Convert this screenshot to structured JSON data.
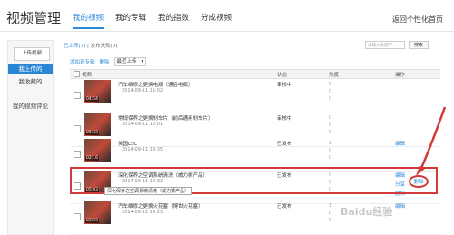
{
  "app_title": "视频管理",
  "tabs": [
    "我的视频",
    "我的专辑",
    "我的指数",
    "分成视频"
  ],
  "home_link": "返回个性化首页",
  "sidebar": {
    "upload": "上传视频",
    "items": [
      "我上传的",
      "我收藏的",
      "我的视频评论",
      "我的专辑"
    ]
  },
  "sub_tabs": [
    "已上传(7)",
    "发布失败(0)"
  ],
  "search": {
    "placeholder": "请输入关键字",
    "button": "搜索"
  },
  "toolbar": {
    "add": "添加到专辑",
    "delete": "删除",
    "sort": "最近上传"
  },
  "table_header": {
    "select": "视频",
    "status": "状态",
    "stats": "热度",
    "ops": "操作"
  },
  "rows": [
    {
      "title": "汽车维修之更换电瓶（通俗电瓶）",
      "date": "2014-09-11 15:02",
      "status": "审核中",
      "dur": "04:54",
      "stats": [
        "0",
        "0",
        "0"
      ],
      "ops": []
    },
    {
      "title": "常规保养之更换刹车片（前后通用刹车片）",
      "date": "2014-09-11 15:01",
      "status": "审核中",
      "dur": "05:43",
      "stats": [
        "0",
        "0",
        "0"
      ],
      "ops": []
    },
    {
      "title": "美国LSC",
      "date": "2014-09-11 14:35",
      "status": "已发布",
      "dur": "02:16",
      "stats": [
        "2",
        "0",
        "0"
      ],
      "ops": [
        "编辑"
      ]
    },
    {
      "title": "深化保养之空调系统清洗（威力狮产品）",
      "date": "2014-09-11 14:32",
      "status": "已发布",
      "dur": "05:03",
      "stats": [
        "0",
        "0",
        "0"
      ],
      "ops": [
        "编辑",
        "分享",
        "删除"
      ]
    },
    {
      "title": "汽车维修之更换火花塞（博世火花塞）",
      "date": "2014-09-11 14:23",
      "status": "已发布",
      "dur": "03:23",
      "stats": [
        "1",
        "0",
        "0"
      ],
      "ops": [
        "编辑"
      ]
    }
  ],
  "tooltip": "深化保养之空调系统清洗（威力狮产品）",
  "delete_label": "删除",
  "watermark": "Baidu经验"
}
